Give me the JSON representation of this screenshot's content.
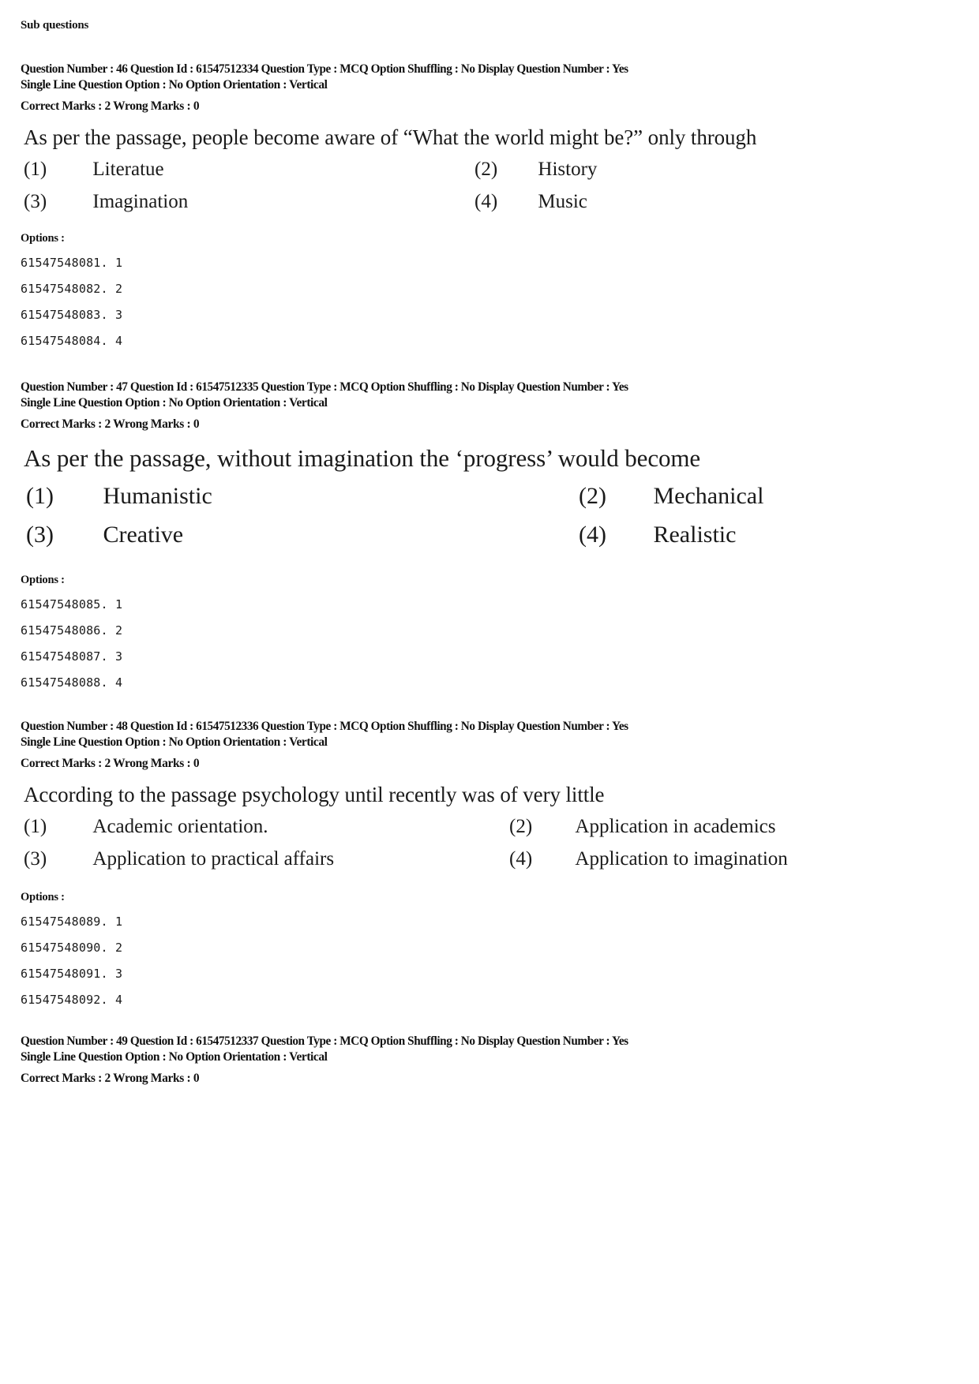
{
  "page": {
    "section_header": "Sub questions"
  },
  "questions": [
    {
      "meta_line1": "Question Number : 46  Question Id : 61547512334  Question Type : MCQ  Option Shuffling : No  Display Question Number : Yes",
      "meta_line2": "Single Line Question Option : No  Option Orientation : Vertical",
      "marks_line": "Correct Marks : 2  Wrong Marks : 0",
      "question_text": "As per the passage, people become aware of “What the world might be?” only through",
      "choices": [
        {
          "num": "(1)",
          "text": "Literatue"
        },
        {
          "num": "(2)",
          "text": "History"
        },
        {
          "num": "(3)",
          "text": "Imagination"
        },
        {
          "num": "(4)",
          "text": "Music"
        }
      ],
      "options_label": "Options :",
      "option_ids": [
        "61547548081. 1",
        "61547548082. 2",
        "61547548083. 3",
        "61547548084. 4"
      ]
    },
    {
      "meta_line1": "Question Number : 47  Question Id : 61547512335  Question Type : MCQ  Option Shuffling : No  Display Question Number : Yes",
      "meta_line2": "Single Line Question Option : No  Option Orientation : Vertical",
      "marks_line": "Correct Marks : 2  Wrong Marks : 0",
      "question_text": "As per the passage, without imagination the ‘progress’ would become",
      "choices": [
        {
          "num": "(1)",
          "text": "Humanistic"
        },
        {
          "num": "(2)",
          "text": "Mechanical"
        },
        {
          "num": "(3)",
          "text": "Creative"
        },
        {
          "num": "(4)",
          "text": "Realistic"
        }
      ],
      "options_label": "Options :",
      "option_ids": [
        "61547548085. 1",
        "61547548086. 2",
        "61547548087. 3",
        "61547548088. 4"
      ]
    },
    {
      "meta_line1": "Question Number : 48  Question Id : 61547512336  Question Type : MCQ  Option Shuffling : No  Display Question Number : Yes",
      "meta_line2": "Single Line Question Option : No  Option Orientation : Vertical",
      "marks_line": "Correct Marks : 2  Wrong Marks : 0",
      "question_text": "According to the passage  psychology until recently was of very little",
      "choices": [
        {
          "num": "(1)",
          "text": "Academic orientation."
        },
        {
          "num": "(2)",
          "text": "Application in academics"
        },
        {
          "num": "(3)",
          "text": "Application to practical affairs"
        },
        {
          "num": "(4)",
          "text": "Application to imagination"
        }
      ],
      "options_label": "Options :",
      "option_ids": [
        "61547548089. 1",
        "61547548090. 2",
        "61547548091. 3",
        "61547548092. 4"
      ]
    },
    {
      "meta_line1": "Question Number : 49  Question Id : 61547512337  Question Type : MCQ  Option Shuffling : No  Display Question Number : Yes",
      "meta_line2": "Single Line Question Option : No  Option Orientation : Vertical",
      "marks_line": "Correct Marks : 2  Wrong Marks : 0"
    }
  ]
}
